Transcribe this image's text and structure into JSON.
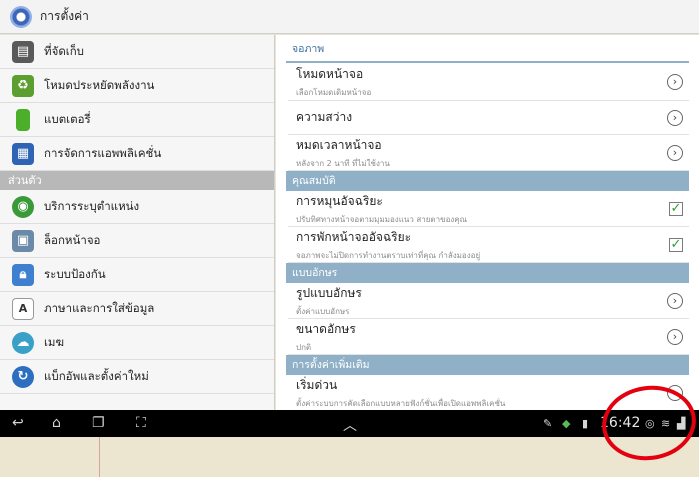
{
  "app": {
    "title": "การตั้งค่า"
  },
  "left_list": {
    "items_top": [
      {
        "label": "ที่จัดเก็บ",
        "icon": "storage-icon",
        "color": "#5a5a5a"
      },
      {
        "label": "โหมดประหยัดพลังงาน",
        "icon": "recycle-icon",
        "color": "#5c9e2f"
      },
      {
        "label": "แบตเตอรี่",
        "icon": "battery-icon",
        "color": "#4caf29"
      },
      {
        "label": "การจัดการแอพพลิเคชั่น",
        "icon": "grid-icon",
        "color": "#2f63b4"
      }
    ],
    "section_personal": "ส่วนตัว",
    "items_personal": [
      {
        "label": "บริการระบุตำแหน่ง",
        "icon": "location-icon",
        "color": "#3a9a3a"
      },
      {
        "label": "ล็อกหน้าจอ",
        "icon": "lockscreen-icon",
        "color": "#6a8aa8"
      },
      {
        "label": "ระบบป้องกัน",
        "icon": "padlock-icon",
        "color": "#3f7fd0"
      },
      {
        "label": "ภาษาและการใส่ข้อมูล",
        "icon": "language-icon",
        "color": "#ffffff"
      },
      {
        "label": "เมฆ",
        "icon": "cloud-icon",
        "color": "#3aa0c8"
      },
      {
        "label": "แบ็กอัพและตั้งค่าใหม่",
        "icon": "backup-icon",
        "color": "#2c6fc0"
      }
    ]
  },
  "right_panel": {
    "section_display": "จอภาพ",
    "items_display": [
      {
        "title": "โหมดหน้าจอ",
        "sub": "เลือกโหมดเดิมหน้าจอ"
      },
      {
        "title": "ความสว่าง",
        "sub": ""
      },
      {
        "title": "หมดเวลาหน้าจอ",
        "sub": "หลังจาก 2 นาที ที่ไม่ใช้งาน"
      }
    ],
    "section_smart": "คุณสมบัติ",
    "items_smart": [
      {
        "title": "การหมุนอัจฉริยะ",
        "sub": "ปรับทิศทางหน้าจอตามมุมมองแนว สายตาของคุณ",
        "checked": true
      },
      {
        "title": "การพักหน้าจออัจฉริยะ",
        "sub": "จอภาพจะไม่ปิดการทำงานตราบเท่าที่คุณ กำลังมองอยู่",
        "checked": true
      }
    ],
    "section_font": "แบบอักษร",
    "items_font": [
      {
        "title": "รูปแบบอักษร",
        "sub": "ตั้งค่าแบบอักษร"
      },
      {
        "title": "ขนาดอักษร",
        "sub": "ปกติ"
      }
    ],
    "section_more": "การตั้งค่าเพิ่มเติม",
    "items_more": [
      {
        "title": "เริ่มด่วน",
        "sub": "ตั้งค่าระบบการคัดเลือกแบบหลายฟังก์ชั่นเพื่อเปิดแอพพลิเคชั่น"
      }
    ]
  },
  "status_bar": {
    "time": "16:42"
  },
  "colors": {
    "accent": "#8fb0c6",
    "checkmark": "#2e9b2e",
    "annotation_circle": "#e3000f"
  }
}
